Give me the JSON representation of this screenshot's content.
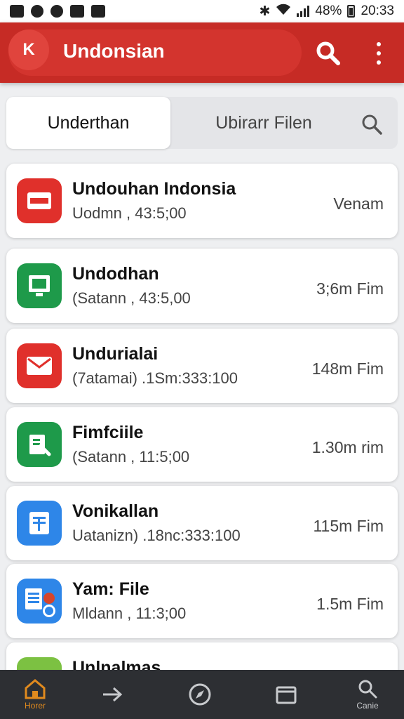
{
  "status_bar": {
    "battery": "48%",
    "time": "20:33"
  },
  "app_bar": {
    "back_label": "K",
    "title": "Undonsian"
  },
  "tabs": {
    "active": "Underthan",
    "second": "Ubirarr Filen"
  },
  "files": [
    {
      "name": "Undouhan Indonsia",
      "sub": "Uodmn , 43:5;00",
      "size": "Venam",
      "icon": "card-icon",
      "color": "#e0302b"
    },
    {
      "name": "Undodhan",
      "sub": "(Satann , 43:5,00",
      "size": "3;6m Fim",
      "icon": "monitor-icon",
      "color": "#1e9a4a"
    },
    {
      "name": "Undurialai",
      "sub": "(7atamai) .1Sm:333:100",
      "size": "148m Fim",
      "icon": "mail-icon",
      "color": "#e0302b"
    },
    {
      "name": "Fimfciile",
      "sub": "(Satann , 11:5;00",
      "size": "1.30m rim",
      "icon": "file-icon",
      "color": "#1e9a4a"
    },
    {
      "name": "Vonikallan",
      "sub": "Uatanizn) .18nc:333:100",
      "size": "115m Fim",
      "icon": "document-icon",
      "color": "#2e86e8"
    },
    {
      "name": "Yam: File",
      "sub": "Mldann , 11:3;00",
      "size": "1.5m Fim",
      "icon": "notes-icon",
      "color": "#2e86e8"
    },
    {
      "name": "Unlnalmas",
      "sub": "",
      "size": "",
      "icon": "folder-icon",
      "color": "#7cc142"
    }
  ],
  "bottom_nav": [
    {
      "label": "Horer",
      "icon": "home-icon",
      "color": "#e08a1e"
    },
    {
      "label": "",
      "icon": "arrow-right-icon",
      "color": "#c7c9cc"
    },
    {
      "label": "",
      "icon": "compass-icon",
      "color": "#c7c9cc"
    },
    {
      "label": "",
      "icon": "folder-outline-icon",
      "color": "#c7c9cc"
    },
    {
      "label": "Canie",
      "icon": "search-icon",
      "color": "#c7c9cc"
    }
  ]
}
